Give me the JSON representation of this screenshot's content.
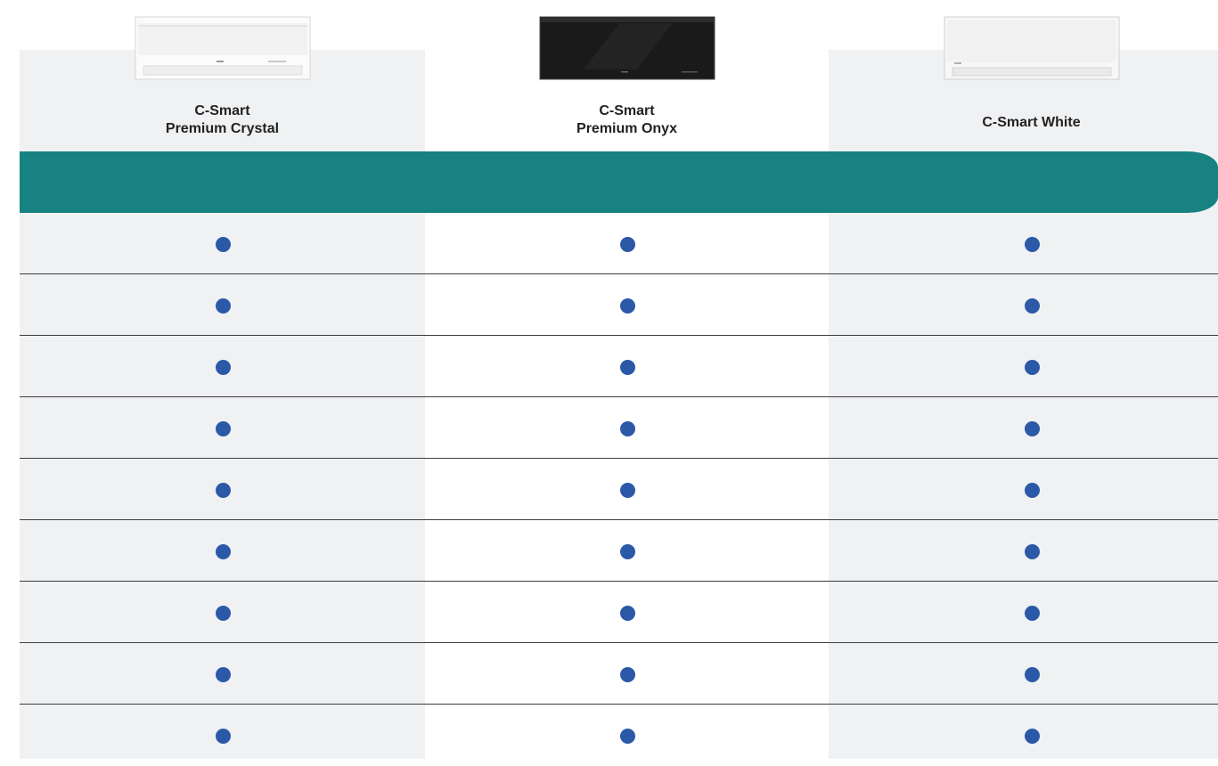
{
  "products": [
    {
      "name_line1": "C-Smart",
      "name_line2": "Premium Crystal",
      "finish": "crystal"
    },
    {
      "name_line1": "C-Smart",
      "name_line2": "Premium Onyx",
      "finish": "onyx"
    },
    {
      "name_line1": "C-Smart White",
      "name_line2": "",
      "finish": "white"
    }
  ],
  "feature_rows": [
    [
      true,
      true,
      true
    ],
    [
      true,
      true,
      true
    ],
    [
      true,
      true,
      true
    ],
    [
      true,
      true,
      true
    ],
    [
      true,
      true,
      true
    ],
    [
      true,
      true,
      true
    ],
    [
      true,
      true,
      true
    ],
    [
      true,
      true,
      true
    ],
    [
      true,
      true,
      true
    ]
  ],
  "colors": {
    "band": "#178280",
    "dot": "#2b59a8",
    "column_shade": "#f0f1f3"
  },
  "icons": {
    "feature_included": "filled-circle-icon"
  }
}
